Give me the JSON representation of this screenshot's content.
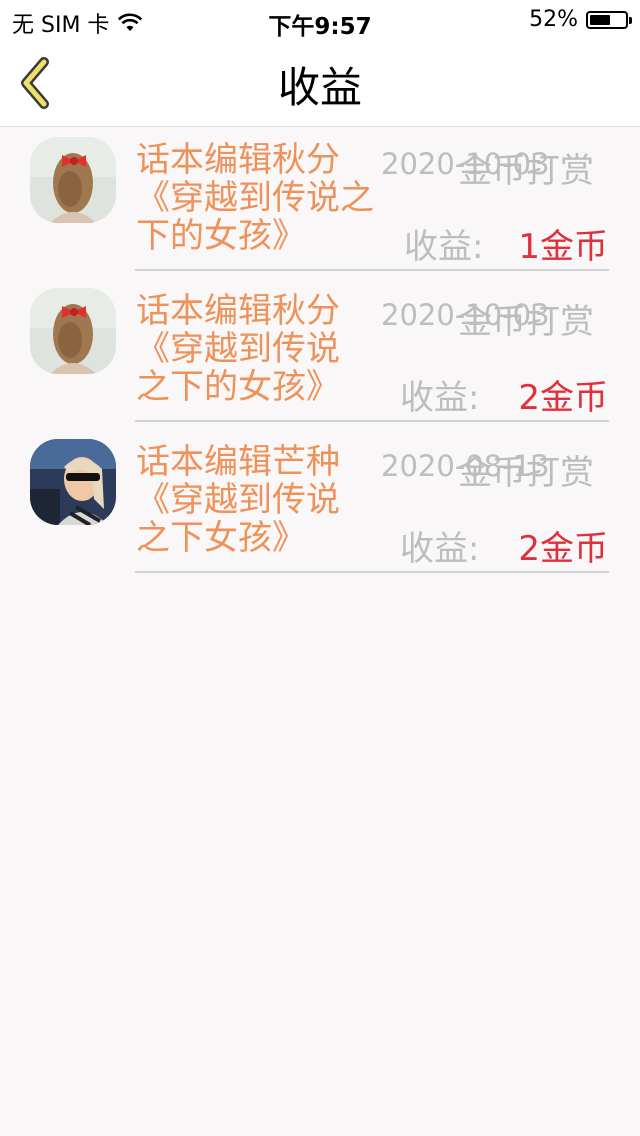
{
  "status_bar": {
    "carrier": "无 SIM 卡",
    "time": "下午9:57",
    "battery": "52%",
    "battery_level": 0.52
  },
  "nav": {
    "title": "收益"
  },
  "items": [
    {
      "title_lines": [
        "话本编辑秋分",
        "《穿越到传说之",
        "下的女孩》"
      ],
      "date": "2020-10-03",
      "type": "金币打赏",
      "earn_label": "收益:",
      "earn_value": "1金币"
    },
    {
      "title_lines": [
        "话本编辑秋分",
        "《穿越到传说",
        "之下的女孩》"
      ],
      "date": "2020-10-03",
      "type": "金币打赏",
      "earn_label": "收益:",
      "earn_value": "2金币"
    },
    {
      "title_lines": [
        "话本编辑芒种",
        "《穿越到传说",
        "之下女孩》"
      ],
      "date": "2020-08-13",
      "type": "金币打赏",
      "earn_label": "收益:",
      "earn_value": "2金币"
    }
  ],
  "colors": {
    "title": "#ee925a",
    "muted": "#bdbdbd",
    "earn": "#e0303b",
    "back_icon": "#f0df6a"
  }
}
